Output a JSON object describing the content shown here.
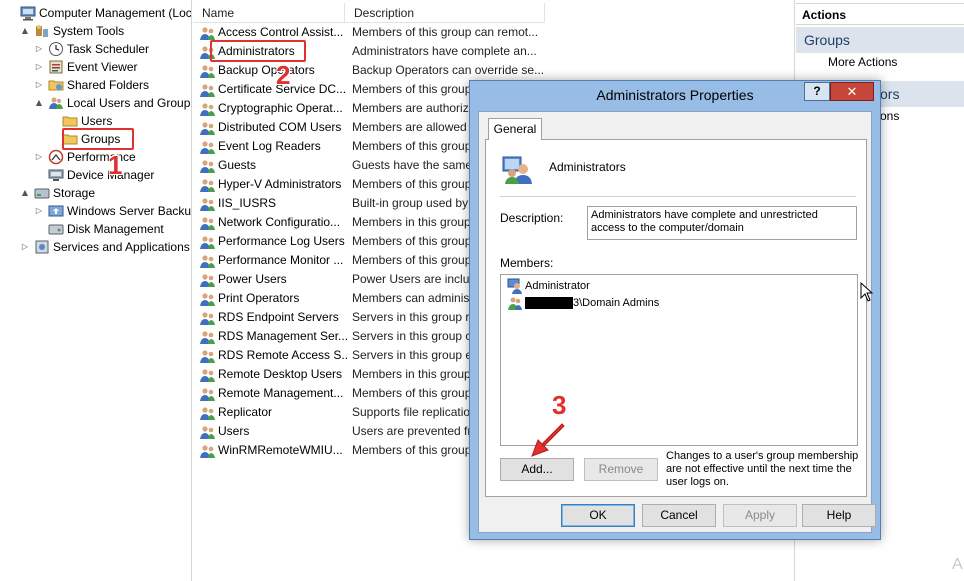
{
  "tree": {
    "items": [
      {
        "label": "Computer Management (Local",
        "icon": "computer-management-icon",
        "indent": 0,
        "arrow": ""
      },
      {
        "label": "System Tools",
        "icon": "system-tools-icon",
        "indent": 1,
        "arrow": "▲"
      },
      {
        "label": "Task Scheduler",
        "icon": "clock-icon",
        "indent": 2,
        "arrow": "▷"
      },
      {
        "label": "Event Viewer",
        "icon": "event-viewer-icon",
        "indent": 2,
        "arrow": "▷"
      },
      {
        "label": "Shared Folders",
        "icon": "shared-folder-icon",
        "indent": 2,
        "arrow": "▷"
      },
      {
        "label": "Local Users and Groups",
        "icon": "users-icon",
        "indent": 2,
        "arrow": "▲"
      },
      {
        "label": "Users",
        "icon": "folder-icon",
        "indent": 3,
        "arrow": ""
      },
      {
        "label": "Groups",
        "icon": "folder-icon",
        "indent": 3,
        "arrow": ""
      },
      {
        "label": "Performance",
        "icon": "performance-icon",
        "indent": 2,
        "arrow": "▷"
      },
      {
        "label": "Device Manager",
        "icon": "device-manager-icon",
        "indent": 2,
        "arrow": ""
      },
      {
        "label": "Storage",
        "icon": "storage-icon",
        "indent": 1,
        "arrow": "▲"
      },
      {
        "label": "Windows Server Backup",
        "icon": "backup-icon",
        "indent": 2,
        "arrow": "▷"
      },
      {
        "label": "Disk Management",
        "icon": "disk-icon",
        "indent": 2,
        "arrow": ""
      },
      {
        "label": "Services and Applications",
        "icon": "services-icon",
        "indent": 1,
        "arrow": "▷"
      }
    ]
  },
  "list": {
    "col_name": "Name",
    "col_desc": "Description",
    "rows": [
      {
        "name": "Access Control Assist...",
        "desc": "Members of this group can remot..."
      },
      {
        "name": "Administrators",
        "desc": "Administrators have complete an..."
      },
      {
        "name": "Backup Operators",
        "desc": "Backup Operators can override se..."
      },
      {
        "name": "Certificate Service DC...",
        "desc": "Members of this group are allowed"
      },
      {
        "name": "Cryptographic Operat...",
        "desc": "Members are authorized"
      },
      {
        "name": "Distributed COM Users",
        "desc": "Members are allowed"
      },
      {
        "name": "Event Log Readers",
        "desc": "Members of this group"
      },
      {
        "name": "Guests",
        "desc": "Guests have the same"
      },
      {
        "name": "Hyper-V Administrators",
        "desc": "Members of this group"
      },
      {
        "name": "IIS_IUSRS",
        "desc": "Built-in group used by"
      },
      {
        "name": "Network Configuratio...",
        "desc": "Members in this group"
      },
      {
        "name": "Performance Log Users",
        "desc": "Members of this group"
      },
      {
        "name": "Performance Monitor ...",
        "desc": "Members of this group"
      },
      {
        "name": "Power Users",
        "desc": "Power Users are included"
      },
      {
        "name": "Print Operators",
        "desc": "Members can administer"
      },
      {
        "name": "RDS Endpoint Servers",
        "desc": "Servers in this group run"
      },
      {
        "name": "RDS Management Ser...",
        "desc": "Servers in this group can"
      },
      {
        "name": "RDS Remote Access S...",
        "desc": "Servers in this group enable"
      },
      {
        "name": "Remote Desktop Users",
        "desc": "Members in this group"
      },
      {
        "name": "Remote Management...",
        "desc": "Members of this group"
      },
      {
        "name": "Replicator",
        "desc": "Supports file replication"
      },
      {
        "name": "Users",
        "desc": "Users are prevented from"
      },
      {
        "name": "WinRMRemoteWMIU...",
        "desc": "Members of this group"
      }
    ]
  },
  "actions": {
    "title": "Actions",
    "section1": "Groups",
    "more_actions": "More Actions",
    "section2_visible": "ors",
    "item2_visible": "ons"
  },
  "dialog": {
    "title": "Administrators Properties",
    "help_glyph": "?",
    "close_glyph": "✕",
    "tab": "General",
    "group_name": "Administrators",
    "desc_label": "Description:",
    "desc_value": "Administrators have complete and unrestricted access to the computer/domain",
    "members_label": "Members:",
    "members": [
      {
        "name": "Administrator",
        "icon": "user-icon",
        "redacted": false
      },
      {
        "name": "3\\Domain Admins",
        "icon": "group-icon",
        "redacted": true
      }
    ],
    "add_label": "Add...",
    "remove_label": "Remove",
    "note": "Changes to a user's group membership are not effective until the next time the user logs on.",
    "ok_label": "OK",
    "cancel_label": "Cancel",
    "apply_label": "Apply",
    "help_label": "Help"
  },
  "annotations": {
    "step1": "1",
    "step2": "2",
    "step3": "3",
    "color": "#e0302f"
  },
  "corner_text": "A"
}
